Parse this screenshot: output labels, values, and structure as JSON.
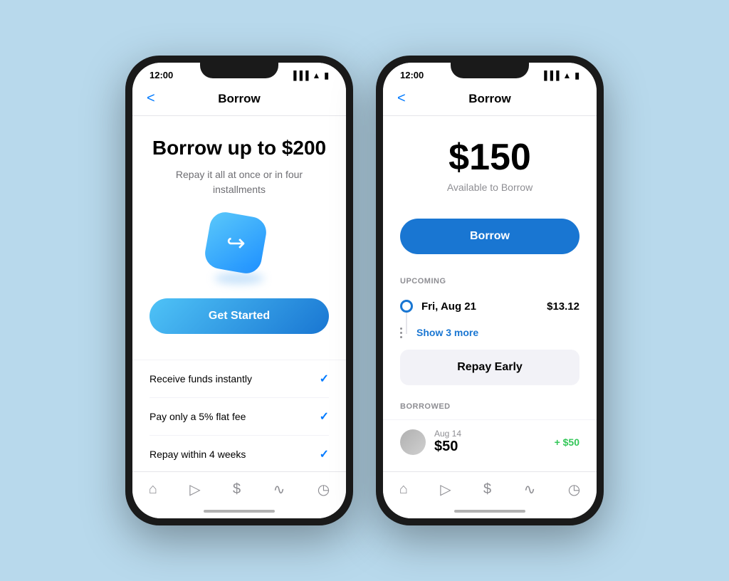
{
  "background": "#b8d9ec",
  "phone1": {
    "statusBar": {
      "time": "12:00",
      "icons": "▐▐▐ ▲ ▮"
    },
    "nav": {
      "backLabel": "<",
      "title": "Borrow"
    },
    "hero": {
      "title": "Borrow up to $200",
      "subtitle": "Repay it all at once or in four installments",
      "iconAlt": "borrow-arrow-icon"
    },
    "getStartedButton": "Get Started",
    "features": [
      {
        "label": "Receive funds instantly"
      },
      {
        "label": "Pay only a 5% flat fee"
      },
      {
        "label": "Repay within 4 weeks"
      }
    ],
    "tabs": [
      {
        "icon": "⌂",
        "label": ""
      },
      {
        "icon": "▷",
        "label": ""
      },
      {
        "icon": "$",
        "label": ""
      },
      {
        "icon": "∿",
        "label": ""
      },
      {
        "icon": "◷",
        "label": ""
      }
    ]
  },
  "phone2": {
    "statusBar": {
      "time": "12:00",
      "icons": "▐▐▐ ▲ ▮"
    },
    "nav": {
      "backLabel": "<",
      "title": "Borrow"
    },
    "amount": {
      "value": "$150",
      "label": "Available to Borrow"
    },
    "borrowButton": "Borrow",
    "upcomingSection": {
      "label": "UPCOMING",
      "items": [
        {
          "date": "Fri, Aug 21",
          "amount": "$13.12"
        }
      ],
      "showMore": "Show 3 more"
    },
    "repayButton": "Repay Early",
    "borrowedSection": {
      "label": "BORROWED",
      "items": [
        {
          "date": "Aug 14",
          "amount": "$50",
          "change": "+ $50"
        }
      ]
    },
    "tabs": [
      {
        "icon": "⌂",
        "label": ""
      },
      {
        "icon": "▷",
        "label": ""
      },
      {
        "icon": "$",
        "label": ""
      },
      {
        "icon": "∿",
        "label": ""
      },
      {
        "icon": "◷",
        "label": ""
      }
    ]
  }
}
